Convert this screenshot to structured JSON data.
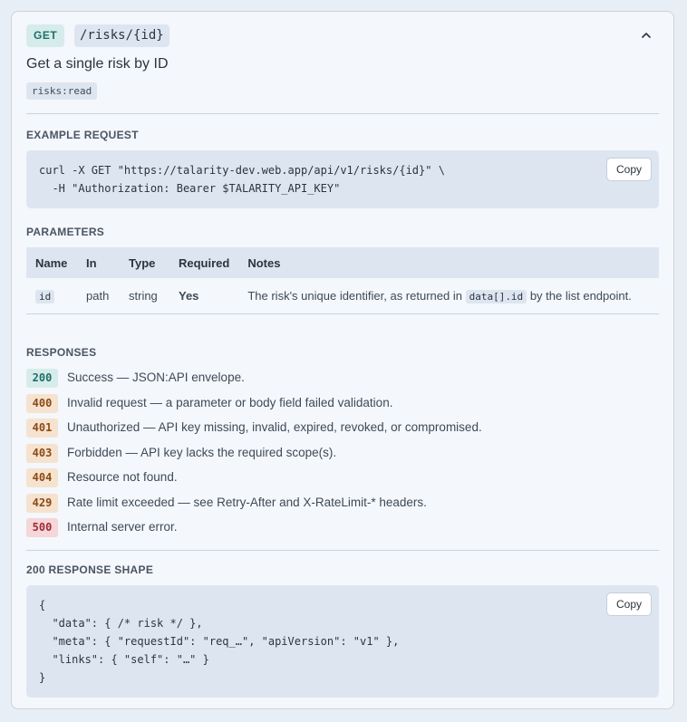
{
  "endpoint": {
    "method": "GET",
    "path": "/risks/{id}",
    "summary": "Get a single risk by ID",
    "scope": "risks:read"
  },
  "example_request": {
    "title": "EXAMPLE REQUEST",
    "code": "curl -X GET \"https://talarity-dev.web.app/api/v1/risks/{id}\" \\\n  -H \"Authorization: Bearer $TALARITY_API_KEY\"",
    "copy_label": "Copy"
  },
  "parameters": {
    "title": "PARAMETERS",
    "columns": [
      "Name",
      "In",
      "Type",
      "Required",
      "Notes"
    ],
    "rows": [
      {
        "name": "id",
        "in": "path",
        "type": "string",
        "required": "Yes",
        "notes_before": "The risk's unique identifier, as returned in",
        "notes_code": "data[].id",
        "notes_after": "by the list endpoint."
      }
    ]
  },
  "responses": {
    "title": "RESPONSES",
    "items": [
      {
        "code": "200",
        "desc": "Success — JSON:API envelope.",
        "bg": "#d6ecea",
        "fg": "#1e6f66"
      },
      {
        "code": "400",
        "desc": "Invalid request — a parameter or body field failed validation.",
        "bg": "#f6e3cf",
        "fg": "#8a4a14"
      },
      {
        "code": "401",
        "desc": "Unauthorized — API key missing, invalid, expired, revoked, or compromised.",
        "bg": "#f6e3cf",
        "fg": "#8a4a14"
      },
      {
        "code": "403",
        "desc": "Forbidden — API key lacks the required scope(s).",
        "bg": "#f6e3cf",
        "fg": "#8a4a14"
      },
      {
        "code": "404",
        "desc": "Resource not found.",
        "bg": "#f6e3cf",
        "fg": "#8a4a14"
      },
      {
        "code": "429",
        "desc": "Rate limit exceeded — see Retry-After and X-RateLimit-* headers.",
        "bg": "#f6e3cf",
        "fg": "#8a4a14"
      },
      {
        "code": "500",
        "desc": "Internal server error.",
        "bg": "#f5d6d9",
        "fg": "#9c2b36"
      }
    ]
  },
  "response_shape": {
    "title": "200 RESPONSE SHAPE",
    "code": "{\n  \"data\": { /* risk */ },\n  \"meta\": { \"requestId\": \"req_…\", \"apiVersion\": \"v1\" },\n  \"links\": { \"self\": \"…\" }\n}",
    "copy_label": "Copy"
  },
  "icons": {
    "collapse": "chevron-up-icon"
  }
}
